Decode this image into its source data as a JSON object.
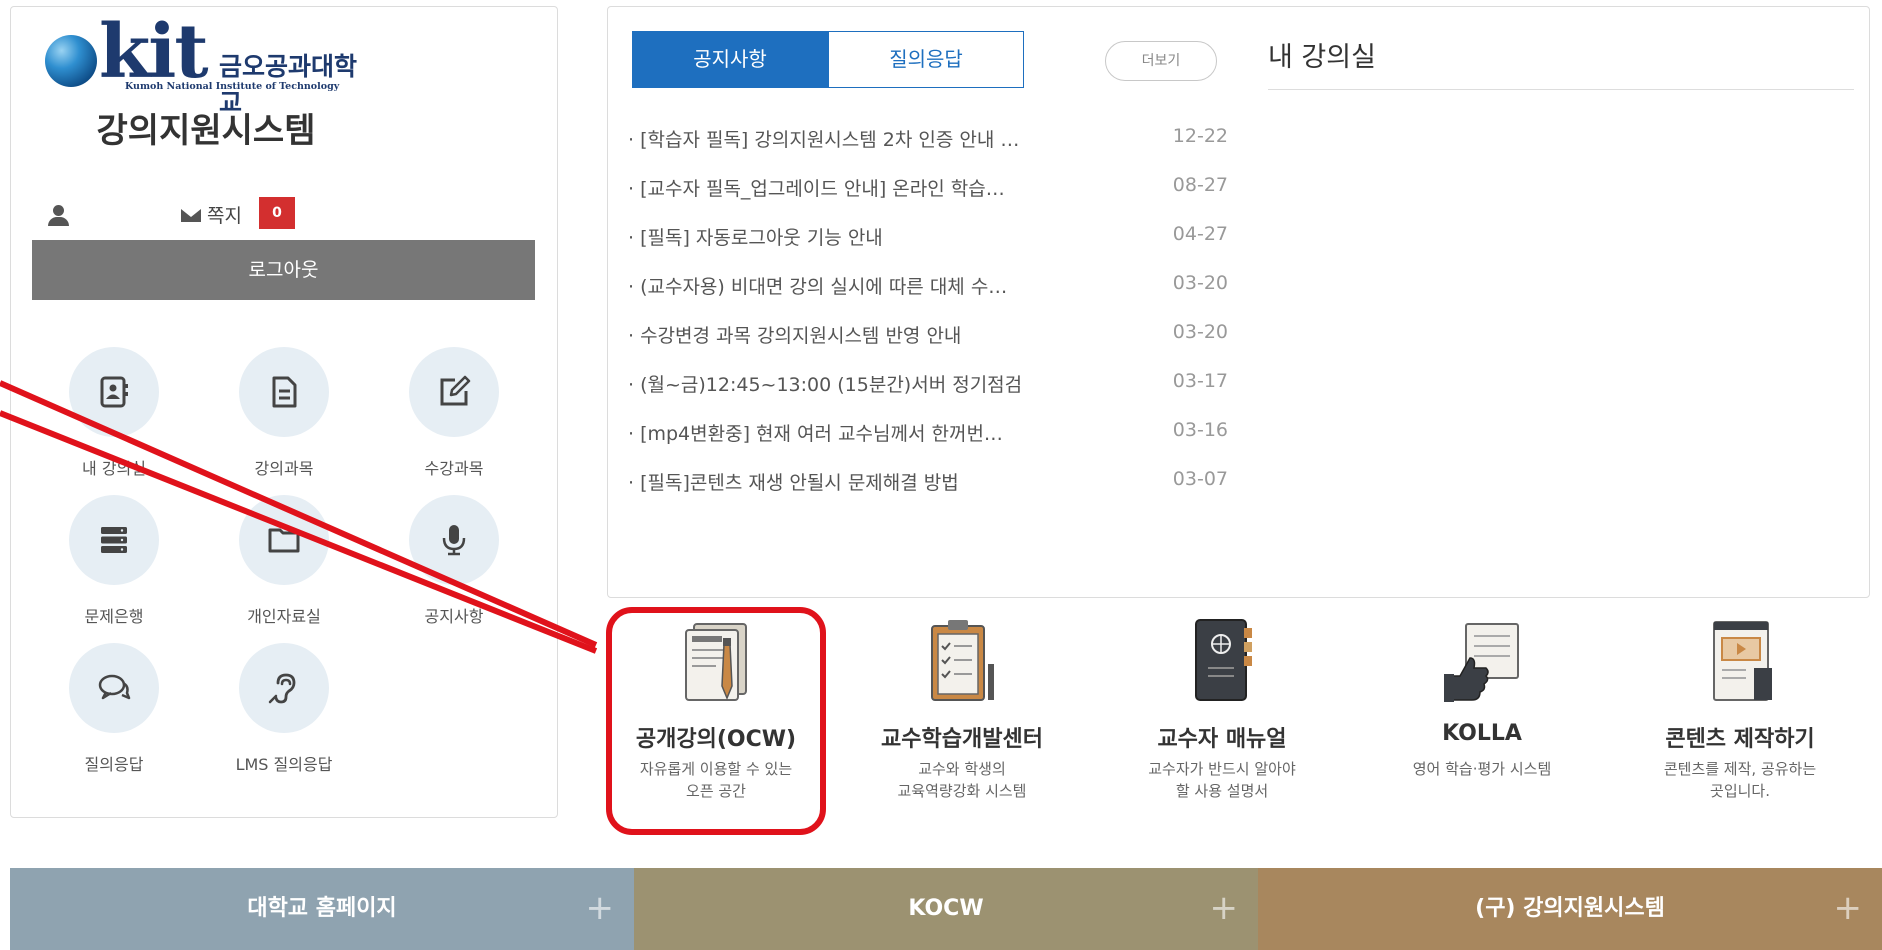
{
  "logo": {
    "wordmark": "kit",
    "korean_name": "금오공과대학교",
    "english_name": "Kumoh National Institute of Technology"
  },
  "system_title": "강의지원시스템",
  "user": {
    "message_label": "쪽지",
    "message_count": "0"
  },
  "logout_label": "로그아웃",
  "menu": [
    {
      "label": "내 강의실",
      "icon": "contact-book-icon"
    },
    {
      "label": "강의과목",
      "icon": "document-icon"
    },
    {
      "label": "수강과목",
      "icon": "edit-icon"
    },
    {
      "label": "문제은행",
      "icon": "database-icon"
    },
    {
      "label": "개인자료실",
      "icon": "folder-icon"
    },
    {
      "label": "공지사항",
      "icon": "microphone-icon"
    },
    {
      "label": "질의응답",
      "icon": "chat-icon"
    },
    {
      "label": "LMS 질의응답",
      "icon": "hearing-icon"
    }
  ],
  "board": {
    "tabs": [
      "공지사항",
      "질의응답"
    ],
    "more_label": "더보기",
    "notices": [
      {
        "title": "· [학습자 필독] 강의지원시스템 2차 인증 안내 …",
        "date": "12-22"
      },
      {
        "title": "· [교수자 필독_업그레이드 안내] 온라인 학습…",
        "date": "08-27"
      },
      {
        "title": "· [필독] 자동로그아웃 기능 안내",
        "date": "04-27"
      },
      {
        "title": "· (교수자용) 비대면 강의 실시에 따른 대체 수…",
        "date": "03-20"
      },
      {
        "title": "· 수강변경 과목 강의지원시스템 반영 안내",
        "date": "03-20"
      },
      {
        "title": "· (월~금)12:45~13:00 (15분간)서버 정기점검",
        "date": "03-17"
      },
      {
        "title": "· [mp4변환중] 현재 여러 교수님께서 한꺼번…",
        "date": "03-16"
      },
      {
        "title": "· [필독]콘텐츠 재생 안될시 문제해결 방법",
        "date": "03-07"
      }
    ]
  },
  "classroom": {
    "title": "내 강의실"
  },
  "quick_links": [
    {
      "title": "공개강의(OCW)",
      "desc1": "자유롭게 이용할 수 있는",
      "desc2": "오픈 공간",
      "icon": "notebook-pen-icon"
    },
    {
      "title": "교수학습개발센터",
      "desc1": "교수와 학생의",
      "desc2": "교육역량강화 시스템",
      "icon": "clipboard-icon"
    },
    {
      "title": "교수자 매뉴얼",
      "desc1": "교수자가 반드시 알아야",
      "desc2": "할 사용 설명서",
      "icon": "manual-book-icon"
    },
    {
      "title": "KOLLA",
      "desc1": "영어 학습·평가 시스템",
      "desc2": "",
      "icon": "thumbs-up-icon"
    },
    {
      "title": "콘텐츠 제작하기",
      "desc1": "콘텐츠를 제작, 공유하는",
      "desc2": "곳입니다.",
      "icon": "video-content-icon"
    }
  ],
  "bottom_links": [
    {
      "label": "대학교 홈페이지",
      "color": "#8fa3b0"
    },
    {
      "label": "KOCW",
      "color": "#9c9271"
    },
    {
      "label": "(구) 강의지원시스템",
      "color": "#a8875e"
    }
  ],
  "colors": {
    "accent_blue": "#1e6fbf",
    "badge_red": "#d32f2f",
    "highlight_red": "#e0121b",
    "menu_circle": "#e6eef4"
  }
}
